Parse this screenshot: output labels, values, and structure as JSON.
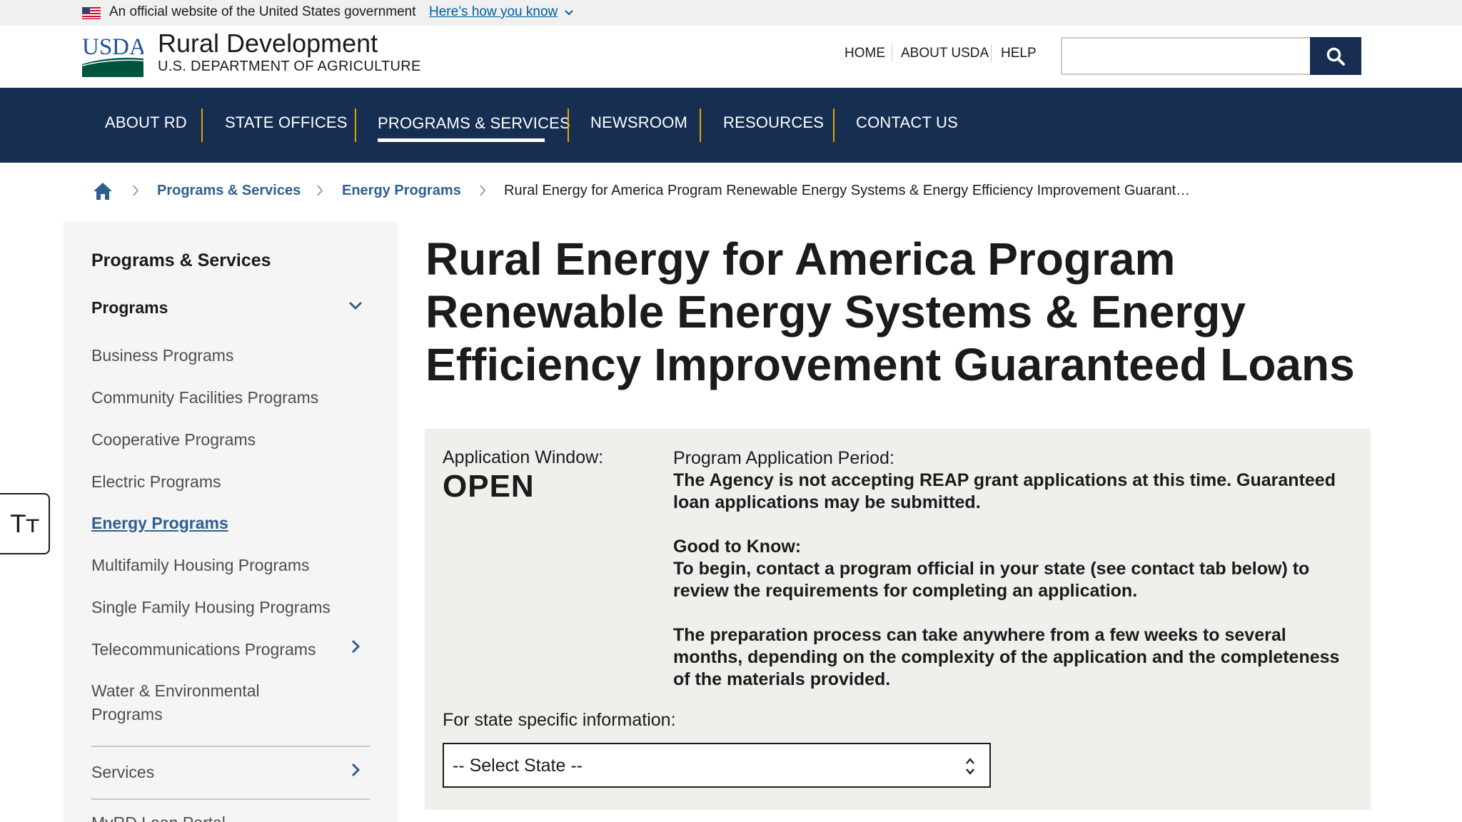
{
  "gov_banner": {
    "text": "An official website of the United States government",
    "link": "Here’s how you know"
  },
  "header": {
    "logo_text": "USDA",
    "site_name": "Rural Development",
    "site_sub": "U.S. DEPARTMENT OF AGRICULTURE",
    "util_nav": [
      "HOME",
      "ABOUT USDA",
      "HELP"
    ],
    "search_placeholder": ""
  },
  "main_nav": {
    "items": [
      "ABOUT RD",
      "STATE OFFICES",
      "PROGRAMS & SERVICES",
      "NEWSROOM",
      "RESOURCES",
      "CONTACT US"
    ],
    "active": "PROGRAMS & SERVICES"
  },
  "breadcrumb": {
    "links": [
      "Programs & Services",
      "Energy Programs"
    ],
    "current": "Rural Energy for America Program Renewable Energy Systems & Energy Efficiency Improvement Guarant…"
  },
  "sidebar": {
    "heading": "Programs & Services",
    "section": "Programs",
    "items": [
      "Business Programs",
      "Community Facilities Programs",
      "Cooperative Programs",
      "Electric Programs",
      "Energy Programs",
      "Multifamily Housing Programs",
      "Single Family Housing Programs",
      "Telecommunications Programs",
      "Water & Environmental Programs"
    ],
    "active_item": "Energy Programs",
    "services": "Services",
    "partial_item": "MyRD Loan Portal"
  },
  "text_resize": {
    "glyph": "Tт"
  },
  "page": {
    "title": "Rural Energy for America Program Renewable Energy Systems & Energy Efficiency Improvement Guaranteed Loans"
  },
  "info_box": {
    "window_label": "Application Window:",
    "window_value": "OPEN",
    "period_label": "Program Application Period:",
    "period_text": "The Agency is not accepting REAP grant applications at this time. Guaranteed loan applications may be submitted.",
    "good_label": "Good to Know:",
    "good_text": "To begin, contact a program official in your state (see contact tab below) to review the requirements for completing an application.",
    "prep_text": "The preparation process can take anywhere from a few weeks to several months, depending on the complexity of the application and the completeness of the materials provided.",
    "state_label": "For state specific information:",
    "state_select": "-- Select State --"
  },
  "colors": {
    "navy": "#162e51",
    "accent_gold": "#e5a000",
    "link_blue": "#2f5f8f",
    "usda_green": "#005440",
    "usda_blue": "#205493"
  }
}
